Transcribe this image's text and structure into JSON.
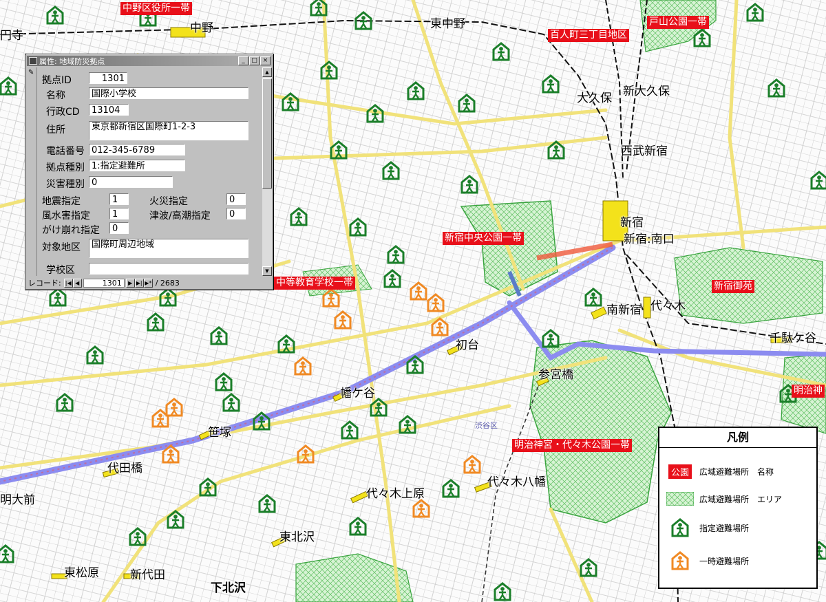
{
  "window": {
    "title": "属性: 地域防災拠点",
    "fields": {
      "id_label": "拠点ID",
      "id_value": "1301",
      "name_label": "名称",
      "name_value": "国際小学校",
      "code_label": "行政CD",
      "code_value": "13104",
      "addr_label": "住所",
      "addr_value": "東京都新宿区国際町1-2-3",
      "tel_label": "電話番号",
      "tel_value": "012-345-6789",
      "type_label": "拠点種別",
      "type_value": "1:指定避難所",
      "disaster_label": "災害種別",
      "disaster_value": "0",
      "quake_label": "地震指定",
      "quake_value": "1",
      "fire_label": "火災指定",
      "fire_value": "0",
      "flood_label": "風水害指定",
      "flood_value": "1",
      "tsunami_label": "津波/高潮指定",
      "tsunami_value": "0",
      "slope_label": "がけ崩れ指定",
      "slope_value": "0",
      "target_label": "対象地区",
      "target_value": "国際町周辺地域",
      "school_label": "学校区",
      "school_value": ""
    },
    "nav": {
      "record_label": "レコード:",
      "current": "1301",
      "total": "/ 2683"
    }
  },
  "areas": [
    "中野区役所一帯",
    "戸山公園一帯",
    "百人町三丁目地区",
    "新宿中央公園一帯",
    "新宿御苑",
    "中等教育学校一帯",
    "明治神宮・代々木公園一帯",
    "明治神"
  ],
  "stations": [
    "中野",
    "東中野",
    "大久保",
    "新大久保",
    "西武新宿",
    "新宿",
    "新宿:南口",
    "南新宿",
    "代々木",
    "千駄ケ谷",
    "初台",
    "参宮橋",
    "幡ケ谷",
    "笹塚",
    "代田橋",
    "代々木上原",
    "代々木八幡",
    "東北沢",
    "東松原",
    "新代田",
    "下北沢",
    "明大前",
    "円寺"
  ],
  "districts": [
    "渋谷区"
  ],
  "legend": {
    "title": "凡例",
    "sample_name": "公園",
    "items": [
      "広域避難場所　名称",
      "広域避難場所　エリア",
      "指定避難場所",
      "一時避難場所"
    ]
  },
  "colors": {
    "designated": "#1b7f2a",
    "temporary": "#f08a24",
    "area_label": "#e8101a",
    "road": "#f1e27a",
    "rail_highlight": "#8c8cf0",
    "park": "#c8efc8"
  }
}
